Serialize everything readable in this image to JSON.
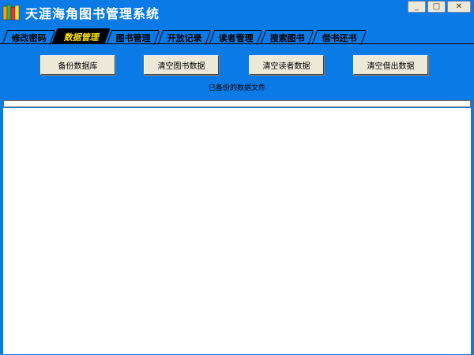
{
  "window": {
    "title": "天涯海角图书管理系统",
    "controls": {
      "minimize": "_",
      "maximize": "□",
      "close": "✕"
    }
  },
  "tabs": [
    {
      "label": "修改密码",
      "active": false
    },
    {
      "label": "数据管理",
      "active": true
    },
    {
      "label": "图书管理",
      "active": false
    },
    {
      "label": "开放记录",
      "active": false
    },
    {
      "label": "读者管理",
      "active": false
    },
    {
      "label": "搜索图书",
      "active": false
    },
    {
      "label": "借书还书",
      "active": false
    }
  ],
  "actions": {
    "backup_db": "备份数据库",
    "clear_books": "清空图书数据",
    "clear_readers": "清空读者数据",
    "clear_loans": "清空借出数据"
  },
  "status_text": "已备份的数据文件",
  "colors": {
    "background": "#0a7ae6",
    "active_tab_text": "#ffe400"
  },
  "icons": {
    "app": "books-icon"
  }
}
